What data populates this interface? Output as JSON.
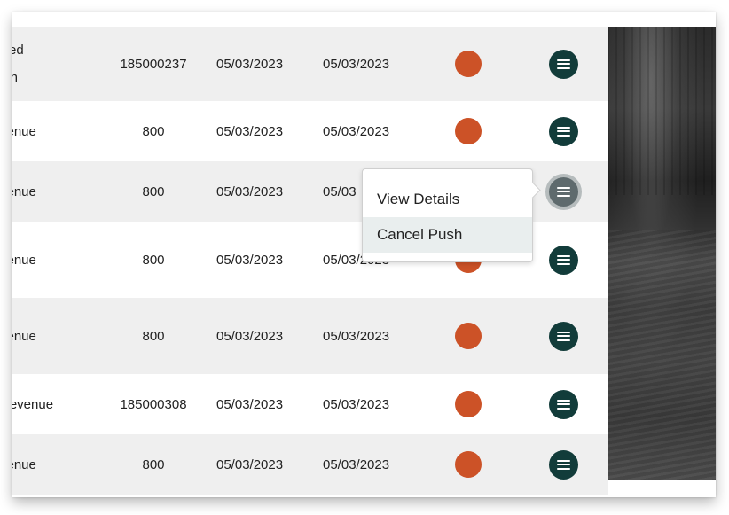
{
  "rows": [
    {
      "name_line1": "rred",
      "name_line2": "ion",
      "amount": "185000237",
      "date1": "05/03/2023",
      "date2": "05/03/2023"
    },
    {
      "name": "venue",
      "amount": "800",
      "date1": "05/03/2023",
      "date2": "05/03/2023"
    },
    {
      "name": "venue",
      "amount": "800",
      "date1": "05/03/2023",
      "date2": "05/03"
    },
    {
      "name": "venue",
      "amount": "800",
      "date1": "05/03/2023",
      "date2": "05/03/2023"
    },
    {
      "name": "venue",
      "amount": "800",
      "date1": "05/03/2023",
      "date2": "05/03/2023"
    },
    {
      "name": "Revenue",
      "amount": "185000308",
      "date1": "05/03/2023",
      "date2": "05/03/2023"
    },
    {
      "name": "venue",
      "amount": "800",
      "date1": "05/03/2023",
      "date2": "05/03/2023"
    }
  ],
  "status_color": "#cc5227",
  "menu_button_color": "#123c3a",
  "row_menu_icon": "hamburger-icon",
  "context_menu": {
    "items": [
      "View Details",
      "Cancel Push"
    ],
    "highlighted": "Cancel Push"
  }
}
